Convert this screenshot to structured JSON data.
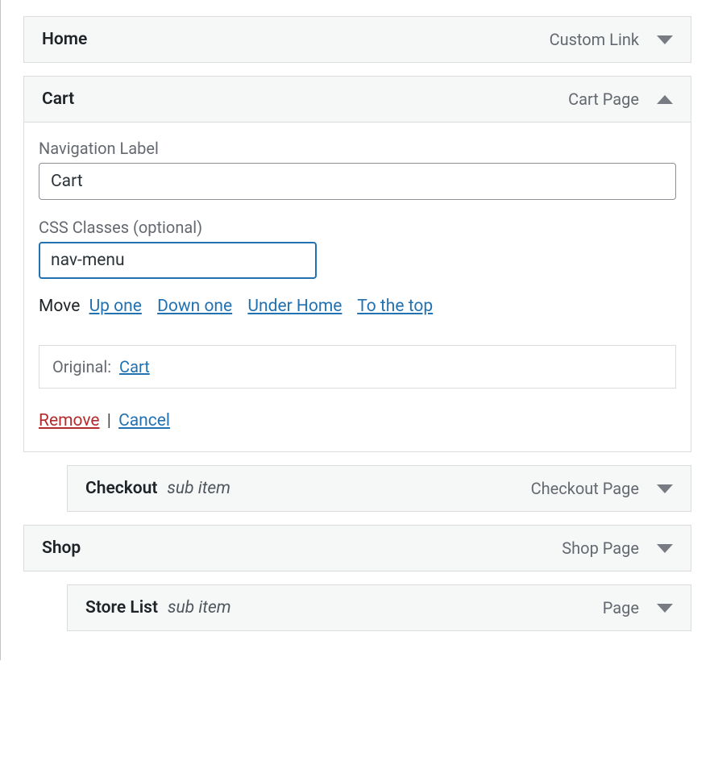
{
  "items": [
    {
      "title": "Home",
      "type": "Custom Link",
      "sub": false,
      "open": false
    },
    {
      "title": "Cart",
      "type": "Cart Page",
      "sub": false,
      "open": true
    },
    {
      "title": "Checkout",
      "type": "Checkout Page",
      "sub": true,
      "open": false
    },
    {
      "title": "Shop",
      "type": "Shop Page",
      "sub": false,
      "open": false
    },
    {
      "title": "Store List",
      "type": "Page",
      "sub": true,
      "open": false
    }
  ],
  "cartPanel": {
    "navLabelLabel": "Navigation Label",
    "navLabelValue": "Cart",
    "cssLabel": "CSS Classes (optional)",
    "cssValue": "nav-menu",
    "moveLabel": "Move",
    "moveUpOne": "Up one",
    "moveDownOne": "Down one",
    "moveUnder": "Under Home",
    "moveTop": "To the top",
    "originalLabel": "Original:",
    "originalLink": "Cart",
    "removeLabel": "Remove",
    "cancelLabel": "Cancel"
  }
}
